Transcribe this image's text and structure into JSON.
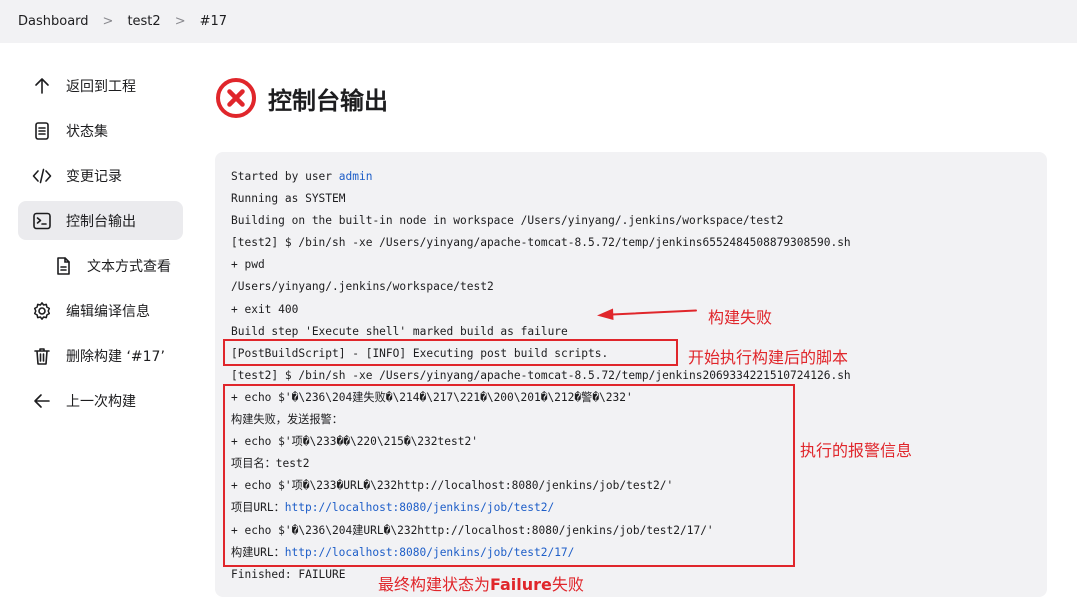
{
  "breadcrumb": {
    "items": [
      "Dashboard",
      "test2",
      "#17"
    ],
    "separator": ">"
  },
  "sidebar": {
    "items": [
      {
        "label": "返回到工程",
        "icon": "arrow-up-icon"
      },
      {
        "label": "状态集",
        "icon": "document-icon"
      },
      {
        "label": "变更记录",
        "icon": "code-icon"
      },
      {
        "label": "控制台输出",
        "icon": "terminal-icon",
        "active": true
      },
      {
        "label": "文本方式查看",
        "icon": "text-file-icon"
      },
      {
        "label": "编辑编译信息",
        "icon": "gear-icon"
      },
      {
        "label": "删除构建 ‘#17’",
        "icon": "trash-icon"
      },
      {
        "label": "上一次构建",
        "icon": "arrow-left-icon"
      }
    ]
  },
  "page": {
    "title": "控制台输出",
    "status_icon": "failure-x-icon",
    "status_color": "#e0262b"
  },
  "console": {
    "started_by_prefix": "Started by user ",
    "started_by_user": "admin",
    "lines": [
      "Running as SYSTEM",
      "Building on the built-in node in workspace /Users/yinyang/.jenkins/workspace/test2",
      "[test2] $ /bin/sh -xe /Users/yinyang/apache-tomcat-8.5.72/temp/jenkins6552484508879308590.sh",
      "+ pwd",
      "/Users/yinyang/.jenkins/workspace/test2",
      "+ exit 400",
      "Build step 'Execute shell' marked build as failure",
      "[PostBuildScript] - [INFO] Executing post build scripts.",
      "[test2] $ /bin/sh -xe /Users/yinyang/apache-tomcat-8.5.72/temp/jenkins2069334221510724126.sh",
      "+ echo $'�\\236\\204建失败�\\214�\\217\\221�\\200\\201�\\212�警�\\232'",
      "构建失败，发送报警：",
      "+ echo $'项�\\233��\\220\\215�\\232test2'",
      "项目名：test2",
      "+ echo $'项�\\233�URL�\\232http://localhost:8080/jenkins/job/test2/'"
    ],
    "project_url_prefix": "项目URL：",
    "project_url": "http://localhost:8080/jenkins/job/test2/",
    "echo_build_url": "+ echo $'�\\236\\204建URL�\\232http://localhost:8080/jenkins/job/test2/17/'",
    "build_url_prefix": "构建URL：",
    "build_url": "http://localhost:8080/jenkins/job/test2/17/",
    "finished": "Finished: FAILURE"
  },
  "annotations": {
    "build_failed": "构建失败",
    "start_post_script": "开始执行构建后的脚本",
    "alert_info": "执行的报警信息",
    "final_status_prefix": "最终构建状态为",
    "final_status_word": "Failure",
    "final_status_suffix": "失败",
    "color": "#e0262b"
  }
}
